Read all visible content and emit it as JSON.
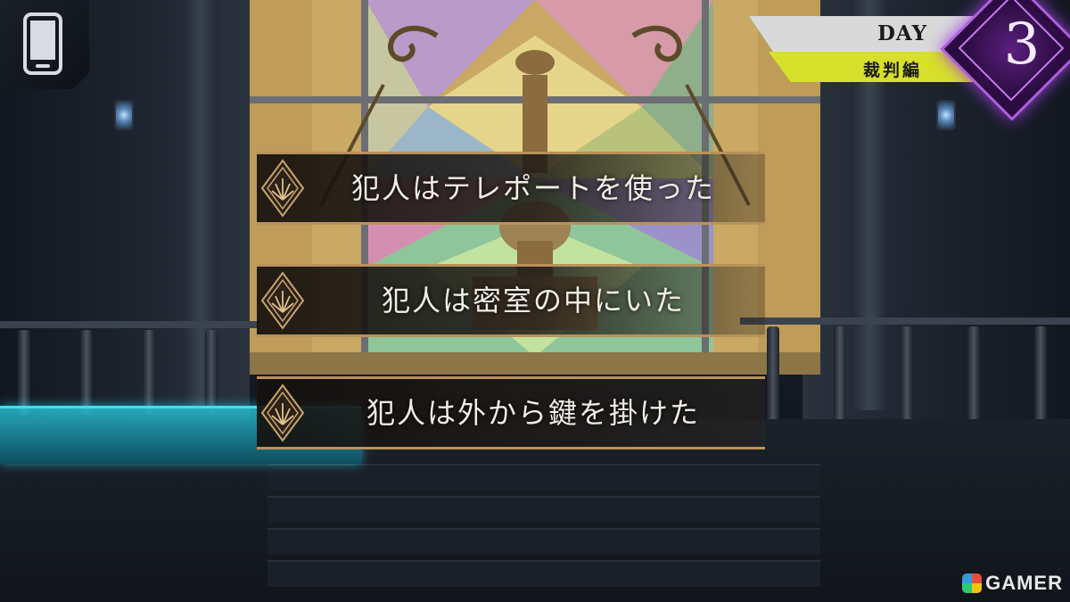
{
  "hud": {
    "phone_icon": "smartphone-icon"
  },
  "day_banner": {
    "day_label": "DAY",
    "chapter": "裁判編",
    "day_number": "3",
    "colors": {
      "accent_yellow": "#d7e02a",
      "diamond_purple": "#5a1f7e"
    }
  },
  "choices": [
    {
      "label": "犯人はテレポートを使った"
    },
    {
      "label": "犯人は密室の中にいた"
    },
    {
      "label": "犯人は外から鍵を掛けた"
    }
  ],
  "watermark": {
    "logo": "gamer-logo",
    "text": "GAMER"
  }
}
